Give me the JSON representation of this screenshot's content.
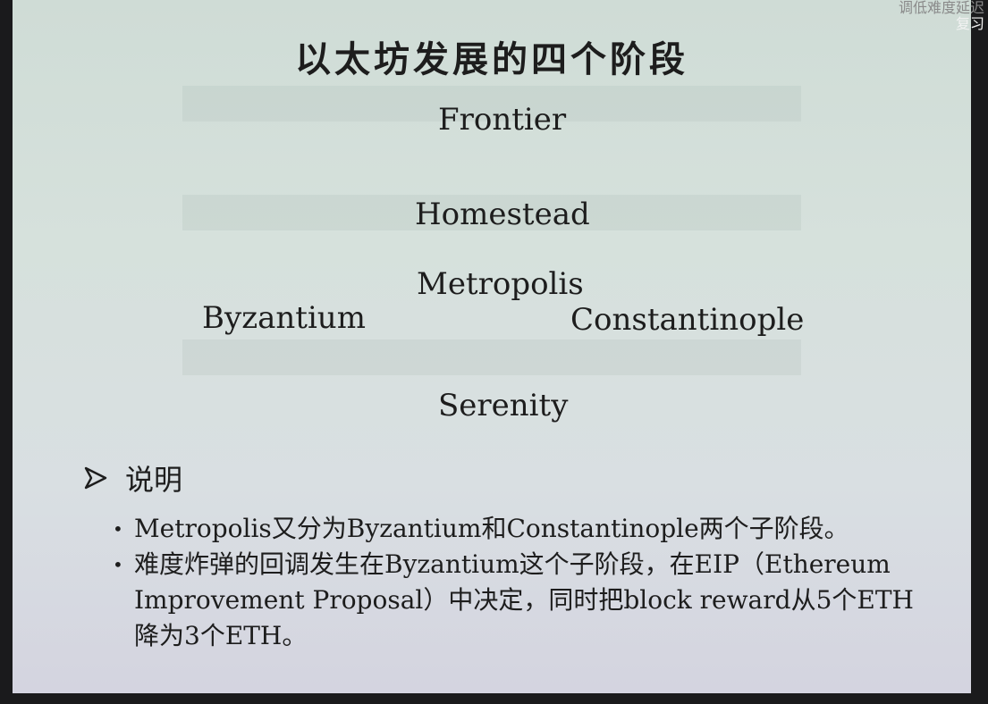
{
  "slide": {
    "title": "以太坊发展的四个阶段",
    "stages": {
      "frontier": "Frontier",
      "homestead": "Homestead",
      "metropolis": "Metropolis",
      "byzantium": "Byzantium",
      "constantinople": "Constantinople",
      "serenity": "Serenity"
    },
    "section_heading": "说明",
    "bullets": [
      "Metropolis又分为Byzantium和Constantinople两个子阶段。",
      "难度炸弹的回调发生在Byzantium这个子阶段，在EIP（Ethereum Improvement Proposal）中决定，同时把block reward从5个ETH降为3个ETH。"
    ]
  },
  "overlay": {
    "line1": "调低难度延迟",
    "line2": "复习"
  },
  "icons": {
    "bullet_arrow": "arrow-right-icon"
  },
  "colors": {
    "text": "#1d1d1d",
    "slide_bg": "#d6e1dc",
    "frame": "#1a1a1c"
  }
}
